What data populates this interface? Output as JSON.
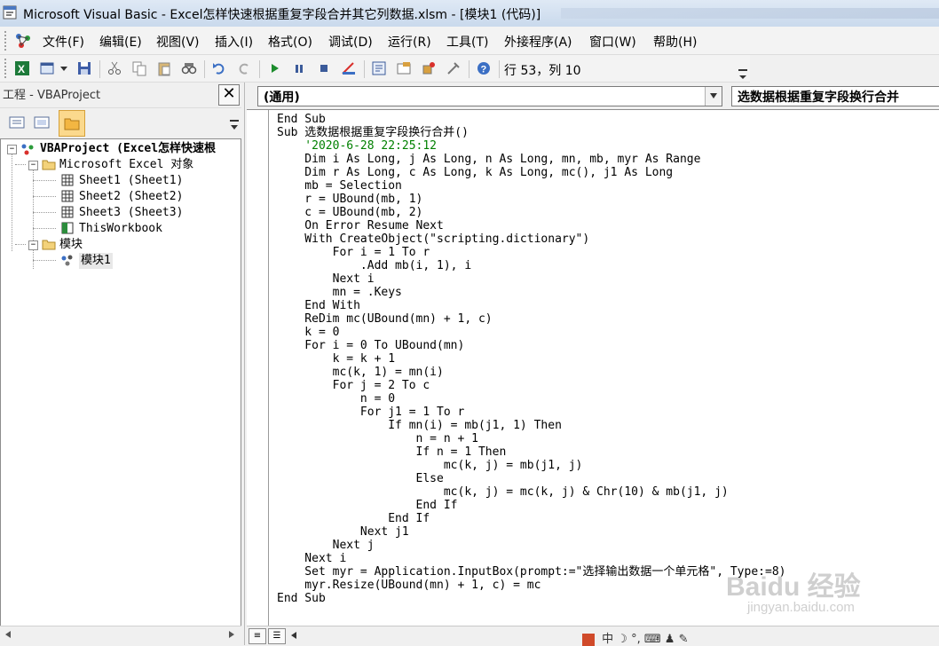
{
  "window": {
    "title": "Microsoft Visual Basic - Excel怎样快速根据重复字段合并其它列数据.xlsm - [模块1 (代码)]"
  },
  "menu": [
    "文件(F)",
    "编辑(E)",
    "视图(V)",
    "插入(I)",
    "格式(O)",
    "调试(D)",
    "运行(R)",
    "工具(T)",
    "外接程序(A)",
    "窗口(W)",
    "帮助(H)"
  ],
  "toolbar": {
    "position": "行 53，列 10"
  },
  "project": {
    "title": "工程 - VBAProject",
    "tree": {
      "root": "VBAProject (Excel怎样快速根",
      "excel_objects": "Microsoft Excel 对象",
      "sheets": [
        "Sheet1 (Sheet1)",
        "Sheet2 (Sheet2)",
        "Sheet3 (Sheet3)"
      ],
      "workbook": "ThisWorkbook",
      "modules_folder": "模块",
      "module": "模块1"
    }
  },
  "editor": {
    "object_combo": "(通用)",
    "proc_combo": "选数据根据重复字段换行合并",
    "code": [
      {
        "t": "End Sub",
        "k": 1
      },
      {
        "t": "Sub 选数据根据重复字段换行合并()",
        "k": 1
      },
      {
        "t": "    '2020-6-28 22:25:12",
        "k": 2
      },
      {
        "t": "    Dim i As Long, j As Long, n As Long, mn, mb, myr As Range",
        "k": 1
      },
      {
        "t": "    Dim r As Long, c As Long, k As Long, mc(), j1 As Long",
        "k": 1
      },
      {
        "t": "    mb = Selection",
        "k": 0
      },
      {
        "t": "    r = UBound(mb, 1)",
        "k": 0
      },
      {
        "t": "    c = UBound(mb, 2)",
        "k": 0
      },
      {
        "t": "    On Error Resume Next",
        "k": 1
      },
      {
        "t": "    With CreateObject(\"scripting.dictionary\")",
        "k": 1
      },
      {
        "t": "        For i = 1 To r",
        "k": 1
      },
      {
        "t": "            .Add mb(i, 1), i",
        "k": 0
      },
      {
        "t": "        Next i",
        "k": 1
      },
      {
        "t": "        mn = .Keys",
        "k": 0
      },
      {
        "t": "    End With",
        "k": 1
      },
      {
        "t": "    ReDim mc(UBound(mn) + 1, c)",
        "k": 1
      },
      {
        "t": "    k = 0",
        "k": 0
      },
      {
        "t": "    For i = 0 To UBound(mn)",
        "k": 1
      },
      {
        "t": "        k = k + 1",
        "k": 0
      },
      {
        "t": "        mc(k, 1) = mn(i)",
        "k": 0
      },
      {
        "t": "        For j = 2 To c",
        "k": 1
      },
      {
        "t": "            n = 0",
        "k": 0
      },
      {
        "t": "            For j1 = 1 To r",
        "k": 1
      },
      {
        "t": "                If mn(i) = mb(j1, 1) Then",
        "k": 1
      },
      {
        "t": "                    n = n + 1",
        "k": 0
      },
      {
        "t": "                    If n = 1 Then",
        "k": 1
      },
      {
        "t": "                        mc(k, j) = mb(j1, j)",
        "k": 0
      },
      {
        "t": "                    Else",
        "k": 1
      },
      {
        "t": "                        mc(k, j) = mc(k, j) & Chr(10) & mb(j1, j)",
        "k": 0
      },
      {
        "t": "                    End If",
        "k": 1
      },
      {
        "t": "                End If",
        "k": 1
      },
      {
        "t": "            Next j1",
        "k": 1
      },
      {
        "t": "        Next j",
        "k": 1
      },
      {
        "t": "    Next i",
        "k": 1
      },
      {
        "t": "    Set myr = Application.InputBox(prompt:=\"选择输出数据一个单元格\", Type:=8)",
        "k": 1
      },
      {
        "t": "    myr.Resize(UBound(mn) + 1, c) = mc",
        "k": 0
      },
      {
        "t": "End Sub",
        "k": 1
      }
    ]
  },
  "ime": "中",
  "watermark": "Baidu 经验",
  "watermark_url": "jingyan.baidu.com",
  "colors": {
    "keyword": "#00008b",
    "comment": "#008000",
    "titlebar": "#c9d9ec"
  }
}
